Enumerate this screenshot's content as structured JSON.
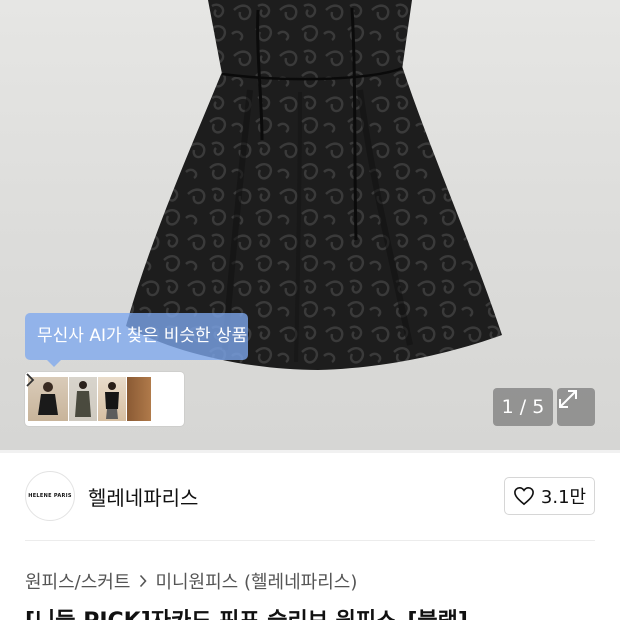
{
  "gallery": {
    "ai_tooltip": "무신사 AI가 찾은 비슷한 상품",
    "counter": "1 / 5",
    "similar_thumbnails": [
      "similar-item-1",
      "similar-item-2",
      "similar-item-3",
      "similar-item-4"
    ]
  },
  "brand": {
    "logo_text": "HELENE PARIS",
    "name": "헬레네파리스",
    "like_count": "3.1만"
  },
  "breadcrumb": {
    "category": "원피스/스커트",
    "subcategory": "미니원피스 (헬레네파리스)"
  },
  "product": {
    "title": "[니들 PICK]자카드 핀포 슬리브 원피스_[블랙]"
  },
  "icons": {
    "chevron": "chevron-right-icon",
    "expand": "expand-icon",
    "heart": "heart-icon"
  }
}
